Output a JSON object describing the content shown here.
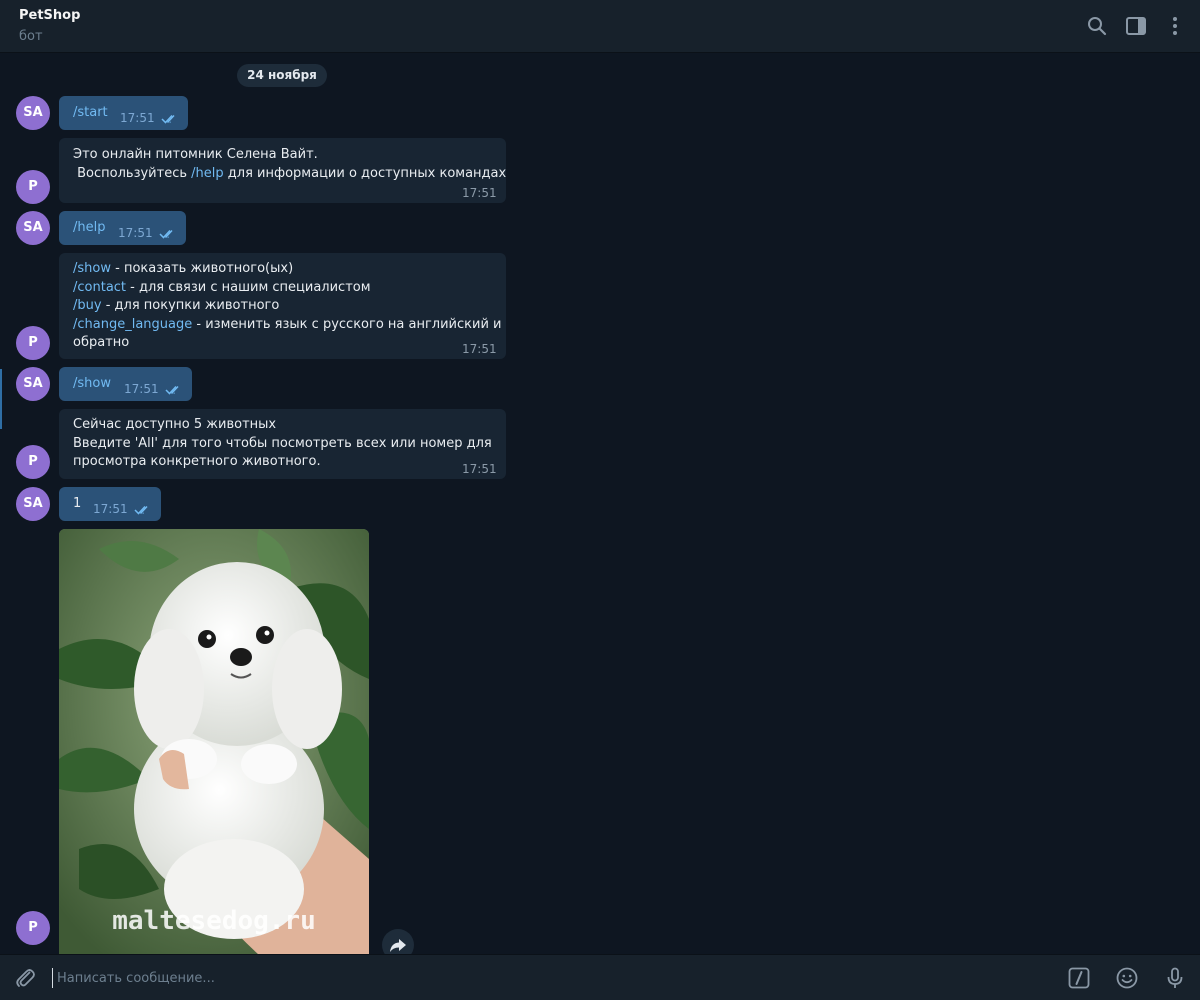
{
  "header": {
    "title": "PetShop",
    "subtitle": "бот",
    "icons": [
      "search-icon",
      "sidebar-toggle-icon",
      "more-vertical-icon"
    ]
  },
  "chat": {
    "date": "24 ноября",
    "messages": [
      {
        "from": "SA",
        "dir": "out",
        "cmd": "/start",
        "time": "17:51"
      },
      {
        "from": "P",
        "dir": "in",
        "line1": "Это онлайн питомник Селена Вайт.",
        "line2_pre": " Воспользуйтесь ",
        "line2_cmd": "/help",
        "line2_post": " для информации о доступных командах",
        "time": "17:51"
      },
      {
        "from": "SA",
        "dir": "out",
        "cmd": "/help",
        "time": "17:51"
      },
      {
        "from": "P",
        "dir": "in",
        "commands": [
          {
            "cmd": "/show",
            "text": " - показать животного(ых)"
          },
          {
            "cmd": "/contact",
            "text": " - для связи с нашим специалистом"
          },
          {
            "cmd": "/buy",
            "text": " - для покупки животного"
          },
          {
            "cmd": "/change_language",
            "text": " - изменить язык с русского на английский и"
          }
        ],
        "tail": "обратно",
        "time": "17:51"
      },
      {
        "from": "SA",
        "dir": "out",
        "cmd": "/show",
        "time": "17:51"
      },
      {
        "from": "P",
        "dir": "in",
        "line1": "Сейчас доступно 5 животных",
        "line2": "Введите 'All' для того чтобы посмотреть всех или номер для",
        "line3": "просмотра конкретного животного.",
        "time": "17:51"
      },
      {
        "from": "SA",
        "dir": "out",
        "text": "1",
        "time": "17:51"
      },
      {
        "from": "P",
        "dir": "in",
        "photo_watermark": "maltesedog.ru"
      }
    ]
  },
  "avatars": {
    "user": "SA",
    "bot": "P"
  },
  "composer": {
    "placeholder": "Написать сообщение...",
    "icons": [
      "attach-icon",
      "bot-commands-icon",
      "emoji-icon",
      "microphone-icon"
    ]
  },
  "colors": {
    "background": "#0e1621",
    "panel": "#17212b",
    "bubble_out": "#2b5278",
    "bubble_in": "#182533",
    "link": "#71baf2",
    "avatar": "#8e6fd1"
  }
}
